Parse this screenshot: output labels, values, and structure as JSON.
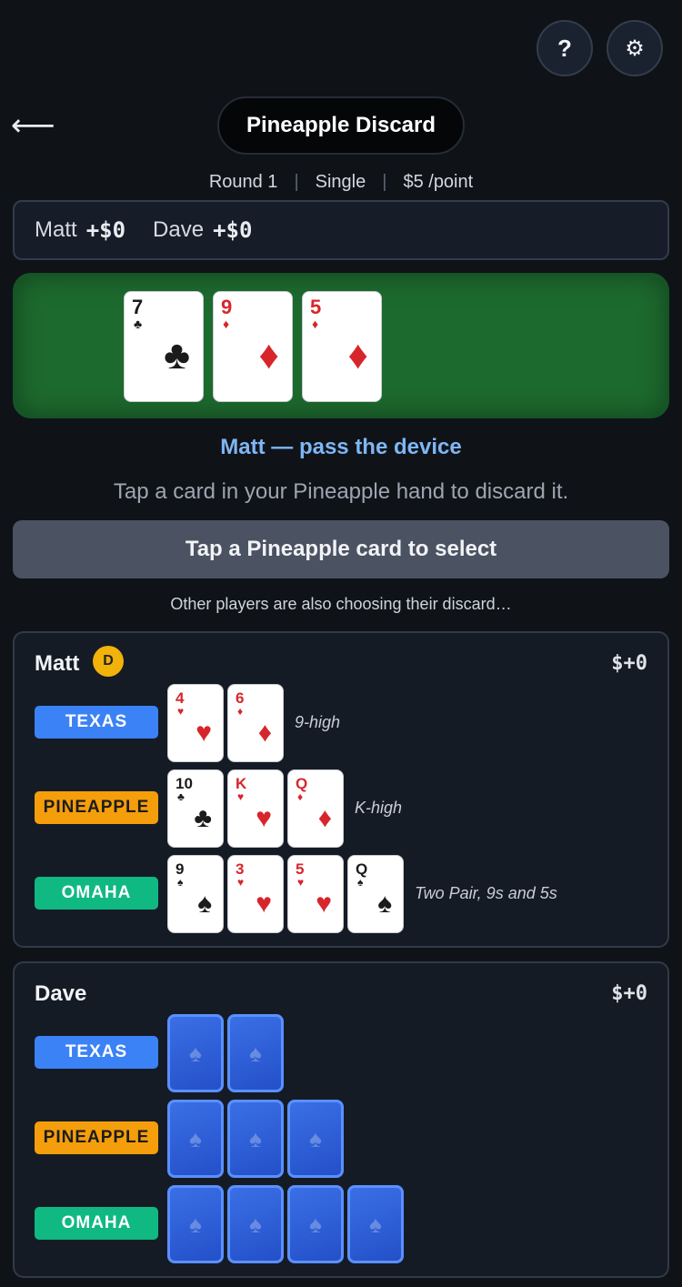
{
  "header": {
    "help_label": "?",
    "settings_icon": "gear-icon",
    "back_icon": "back-arrow-icon",
    "title": "Pineapple Discard",
    "round": "Round 1",
    "mode": "Single",
    "stake": "$5 /point"
  },
  "scores": [
    {
      "name": "Matt",
      "amount": "+$0"
    },
    {
      "name": "Dave",
      "amount": "+$0"
    }
  ],
  "board": {
    "cards": [
      {
        "rank": "7",
        "suit": "♣",
        "color": "black"
      },
      {
        "rank": "9",
        "suit": "♦",
        "color": "red"
      },
      {
        "rank": "5",
        "suit": "♦",
        "color": "red"
      }
    ]
  },
  "prompt": {
    "pass_label": "Matt — pass the device",
    "instruction": "Tap a card in your Pineapple hand to discard it.",
    "select_button": "Tap a Pineapple card to select",
    "others_note": "Other players are also choosing their discard…"
  },
  "players": [
    {
      "name": "Matt",
      "dealer_badge": "D",
      "total": "$+0",
      "hands": [
        {
          "game": "TEXAS",
          "desc": "9-high",
          "cards": [
            {
              "rank": "4",
              "suit": "♥",
              "color": "red"
            },
            {
              "rank": "6",
              "suit": "♦",
              "color": "red"
            }
          ]
        },
        {
          "game": "PINEAPPLE",
          "desc": "K-high",
          "cards": [
            {
              "rank": "10",
              "suit": "♣",
              "color": "black"
            },
            {
              "rank": "K",
              "suit": "♥",
              "color": "red"
            },
            {
              "rank": "Q",
              "suit": "♦",
              "color": "red"
            }
          ]
        },
        {
          "game": "OMAHA",
          "desc": "Two Pair, 9s and 5s",
          "cards": [
            {
              "rank": "9",
              "suit": "♠",
              "color": "black"
            },
            {
              "rank": "3",
              "suit": "♥",
              "color": "red"
            },
            {
              "rank": "5",
              "suit": "♥",
              "color": "red"
            },
            {
              "rank": "Q",
              "suit": "♠",
              "color": "black"
            }
          ]
        }
      ]
    },
    {
      "name": "Dave",
      "total": "$+0",
      "hands": [
        {
          "game": "TEXAS",
          "face_down": 2
        },
        {
          "game": "PINEAPPLE",
          "face_down": 3
        },
        {
          "game": "OMAHA",
          "face_down": 4
        }
      ]
    }
  ],
  "colors": {
    "felt": "#1d6a2e",
    "texas": "#3b82f6",
    "pineapple": "#f59e0b",
    "omaha": "#10b981",
    "accent_text": "#7fb6f4",
    "dealer": "#f1b20a"
  }
}
